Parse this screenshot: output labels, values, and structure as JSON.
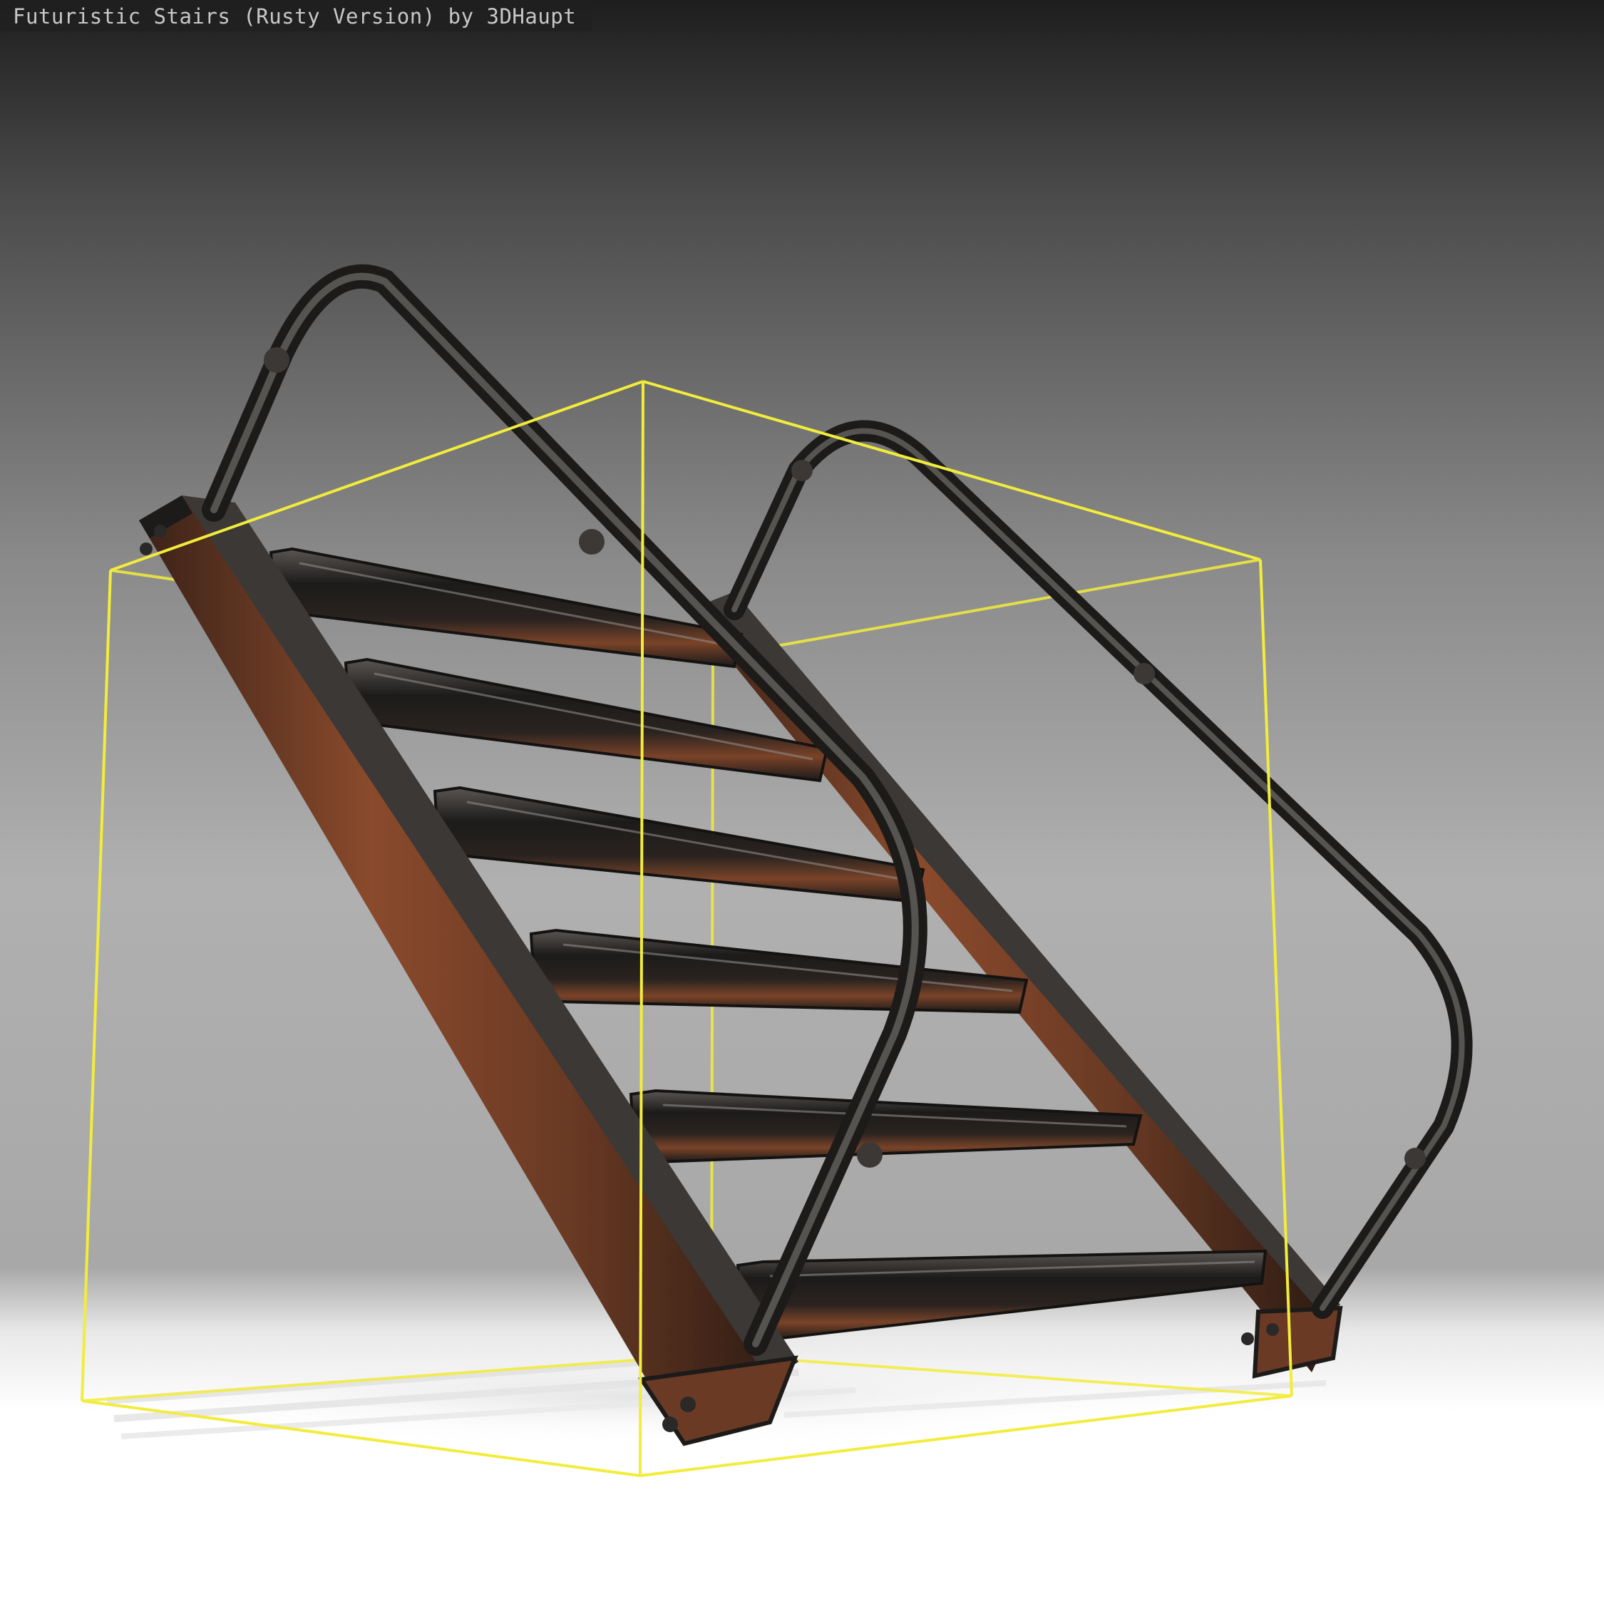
{
  "viewer": {
    "model_title": "Futuristic Stairs (Rusty Version) by 3DHaupt",
    "bounding_box_color": "#f2ec3c",
    "background": {
      "top_color": "#1e1e1e",
      "mid_color": "#9a9a9a",
      "horizon_color": "#bdbdbd",
      "floor_color": "#ffffff"
    },
    "materials": {
      "rust": "#8a4a2c",
      "rust_dark": "#5a2e1c",
      "metal_dark": "#1c1b1a",
      "metal_edge": "#5a5856",
      "metal_highlight": "#8d8a87"
    }
  }
}
